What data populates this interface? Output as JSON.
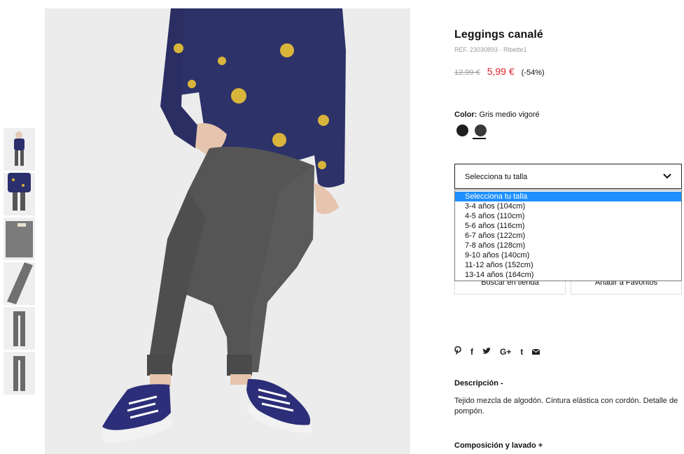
{
  "product": {
    "title": "Leggings canalé",
    "ref": "REF. 23030893 - Ribette1",
    "price_old": "12,99 €",
    "price_new": "5,99 €",
    "discount": "(-54%)"
  },
  "color": {
    "label": "Color:",
    "value": "Gris medio vigoré",
    "swatches": [
      "#1e1e1e",
      "#3a3a3a"
    ]
  },
  "size_select": {
    "value": "Selecciona tu talla",
    "options": [
      "Selecciona tu talla",
      "3-4 años (104cm)",
      "4-5 años (110cm)",
      "5-6 años (116cm)",
      "6-7 años (122cm)",
      "7-8 años (128cm)",
      "9-10 años (140cm)",
      "11-12 años (152cm)",
      "13-14 años (164cm)"
    ]
  },
  "buttons": {
    "store": "Buscar en tienda",
    "favorites": "Añadir a Favoritos"
  },
  "social": {
    "pinterest": "𝗽",
    "facebook": "f",
    "twitter": "🐦",
    "googleplus": "G+",
    "tumblr": "t",
    "email": "✉"
  },
  "description": {
    "heading": "Descripción  -",
    "text": "Tejido mezcla de algodón. Cintura elástica con cordón. Detalle de pompón."
  },
  "composition": {
    "heading": "Composición y lavado  +"
  },
  "icons": {
    "chevron": "chevron-down-icon"
  }
}
